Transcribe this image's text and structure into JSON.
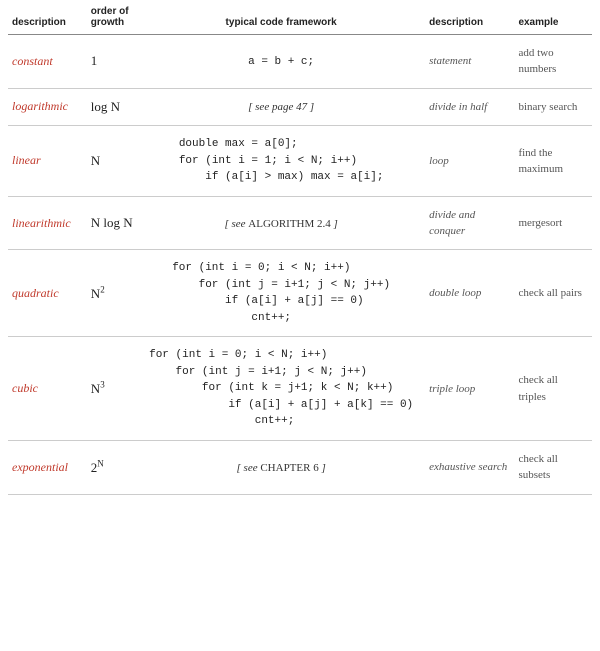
{
  "header": {
    "col1": "description",
    "col2": "order of growth",
    "col3": "typical code framework",
    "col4": "description",
    "col5": "example"
  },
  "rows": [
    {
      "id": "constant",
      "label": "constant",
      "order": "1",
      "order_html": "1",
      "code_type": "text",
      "code": "a = b + c;",
      "desc2": "statement",
      "example": "add two numbers"
    },
    {
      "id": "logarithmic",
      "label": "logarithmic",
      "order_html": "log N",
      "code_type": "ref",
      "code": "[ see page 47 ]",
      "desc2": "divide in half",
      "example": "binary search"
    },
    {
      "id": "linear",
      "label": "linear",
      "order_html": "N",
      "code_type": "multiline",
      "code": "double max = a[0];\nfor (int i = 1; i < N; i++)\n    if (a[i] > max) max = a[i];",
      "desc2": "loop",
      "example": "find the maximum"
    },
    {
      "id": "linearithmic",
      "label": "linearithmic",
      "order_html": "N log N",
      "code_type": "ref",
      "code": "[ see ALGORITHM 2.4 ]",
      "ref_caps": "ALGORITHM 2.4",
      "desc2": "divide and conquer",
      "example": "mergesort"
    },
    {
      "id": "quadratic",
      "label": "quadratic",
      "order_html": "N<sup>2</sup>",
      "code_type": "multiline",
      "code": "for (int i = 0; i < N; i++)\n    for (int j = i+1; j < N; j++)\n        if (a[i] + a[j] == 0)\n            cnt++;",
      "desc2": "double loop",
      "example": "check all pairs"
    },
    {
      "id": "cubic",
      "label": "cubic",
      "order_html": "N<sup>3</sup>",
      "code_type": "multiline",
      "code": "for (int i = 0; i < N; i++)\n    for (int j = i+1; j < N; j++)\n        for (int k = j+1; k < N; k++)\n            if (a[i] + a[j] + a[k] == 0)\n                cnt++;",
      "desc2": "triple loop",
      "example": "check all triples"
    },
    {
      "id": "exponential",
      "label": "exponential",
      "order_html": "2<sup>N</sup>",
      "code_type": "ref",
      "code": "[ see CHAPTER 6 ]",
      "desc2": "exhaustive search",
      "example": "check all subsets"
    }
  ]
}
